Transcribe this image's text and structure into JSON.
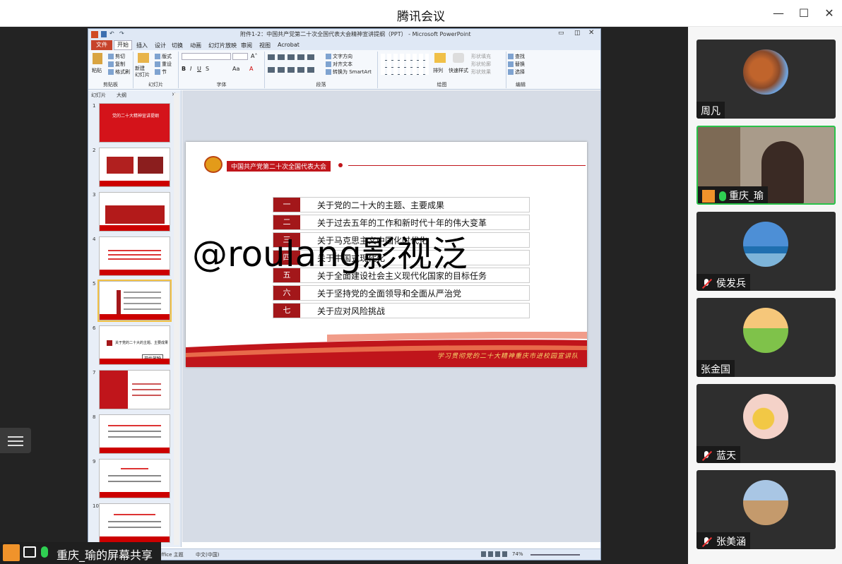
{
  "window": {
    "title": "腾讯会议"
  },
  "share": {
    "label": "重庆_瑜的屏幕共享"
  },
  "ppt": {
    "title": "附件1-2：中国共产党第二十次全国代表大会精神宣讲提纲（PPT） - Microsoft PowerPoint",
    "tabs": [
      "文件",
      "开始",
      "插入",
      "设计",
      "切换",
      "动画",
      "幻灯片放映",
      "审阅",
      "视图",
      "Acrobat"
    ],
    "ribbon": {
      "paste": "粘贴",
      "cut": "剪切",
      "copy": "复制",
      "format_painter": "格式刷",
      "clipboard": "剪贴板",
      "new_slide": "新建\n幻灯片",
      "layout": "版式",
      "reset": "重设",
      "section": "节",
      "slides_group": "幻灯片",
      "font_group": "字体",
      "text_direction": "文字方向",
      "align_text": "对齐文本",
      "smartart": "转换为 SmartArt",
      "paragraph_group": "段落",
      "arrange": "排列",
      "quick_styles": "快速样式",
      "shape_fill": "形状填充",
      "shape_outline": "形状轮廓",
      "shape_effect": "形状效果",
      "drawing_group": "绘图",
      "find": "查找",
      "replace": "替换",
      "select": "选择",
      "editing_group": "编辑"
    },
    "pane_tabs": [
      "幻灯片",
      "大纲"
    ],
    "thumb_numbers": [
      "1",
      "2",
      "3",
      "4",
      "5",
      "6",
      "7",
      "8",
      "9",
      "10"
    ],
    "thumb_1_title": "党的二十大精神宣讲提纲",
    "thumb_6_text": "关于党的二十大的主题、主要成果",
    "tooltip": "开始放映",
    "slide": {
      "header": "中国共产党第二十次全国代表大会",
      "rows": [
        {
          "num": "一",
          "text": "关于党的二十大的主题、主要成果"
        },
        {
          "num": "二",
          "text": "关于过去五年的工作和新时代十年的伟大变革"
        },
        {
          "num": "三",
          "text": "关于马克思主义中国化时代化"
        },
        {
          "num": "四",
          "text": "关于中国式现代化"
        },
        {
          "num": "五",
          "text": "关于全面建设社会主义现代化国家的目标任务"
        },
        {
          "num": "六",
          "text": "关于坚持党的全面领导和全面从严治党"
        },
        {
          "num": "七",
          "text": "关于应对风险挑战"
        }
      ],
      "footer": "学习贯彻党的二十大精神重庆市进校园宣讲队"
    },
    "status": {
      "theme": "Office 主题",
      "language": "中文(中国)",
      "zoom": "74%"
    }
  },
  "watermark": "@roulang影视泛",
  "participants": [
    {
      "name": "周凡",
      "muted": false,
      "mic": false
    },
    {
      "name": "重庆_瑜",
      "muted": false,
      "mic": true
    },
    {
      "name": "侯发兵",
      "muted": true
    },
    {
      "name": "张金国",
      "muted": false,
      "mic": false
    },
    {
      "name": "蓝天",
      "muted": true
    },
    {
      "name": "张美涵",
      "muted": true
    }
  ]
}
